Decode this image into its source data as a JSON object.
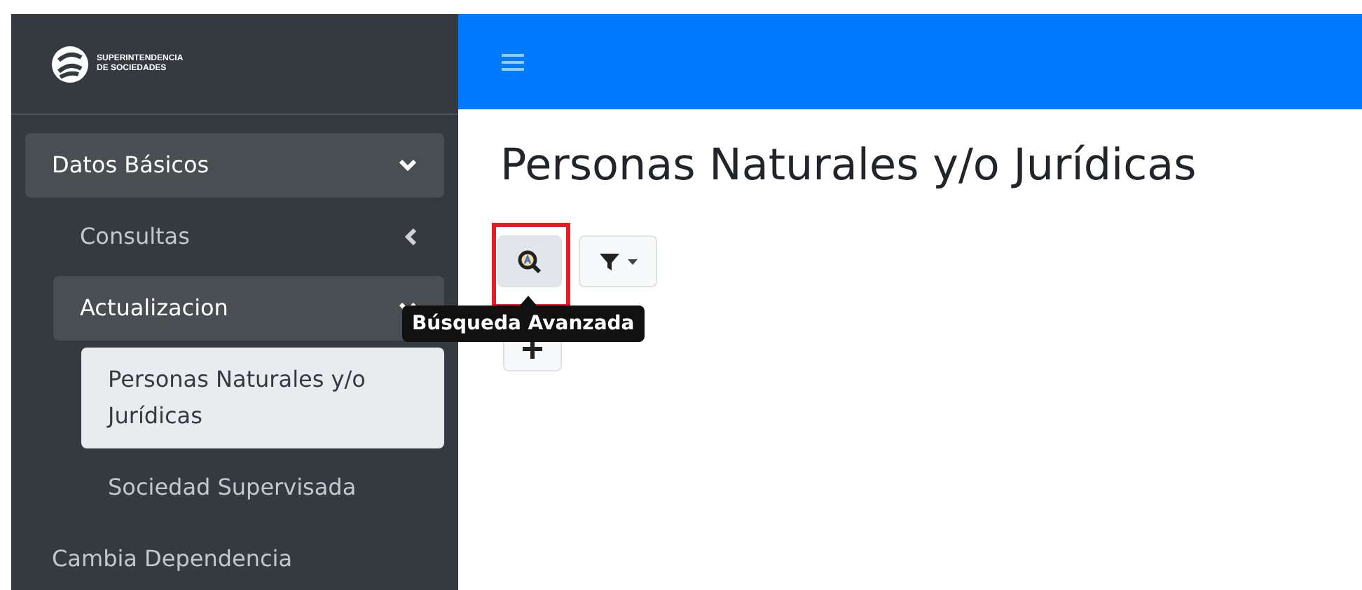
{
  "brand": {
    "line_1": "SUPERINTENDENCIA",
    "line_2": "DE SOCIEDADES"
  },
  "sidebar": {
    "items": [
      {
        "label": "Datos Básicos",
        "expanded": true,
        "children": [
          {
            "label": "Consultas",
            "expanded": false
          },
          {
            "label": "Actualizacion",
            "expanded": true,
            "children": [
              {
                "label": "Personas Naturales y/o Jurídicas",
                "selected": true
              },
              {
                "label": "Sociedad Supervisada",
                "selected": false
              }
            ]
          }
        ]
      },
      {
        "label": "Cambia Dependencia",
        "selected": false
      }
    ]
  },
  "page": {
    "title": "Personas Naturales y/o Jurídicas"
  },
  "toolbar": {
    "buttons": [
      {
        "kind": "search",
        "highlighted": true
      },
      {
        "kind": "filter",
        "highlighted": false
      }
    ],
    "second_row": [
      {
        "kind": "add",
        "highlighted": false
      }
    ]
  },
  "tooltip": {
    "text": "Búsqueda Avanzada"
  }
}
